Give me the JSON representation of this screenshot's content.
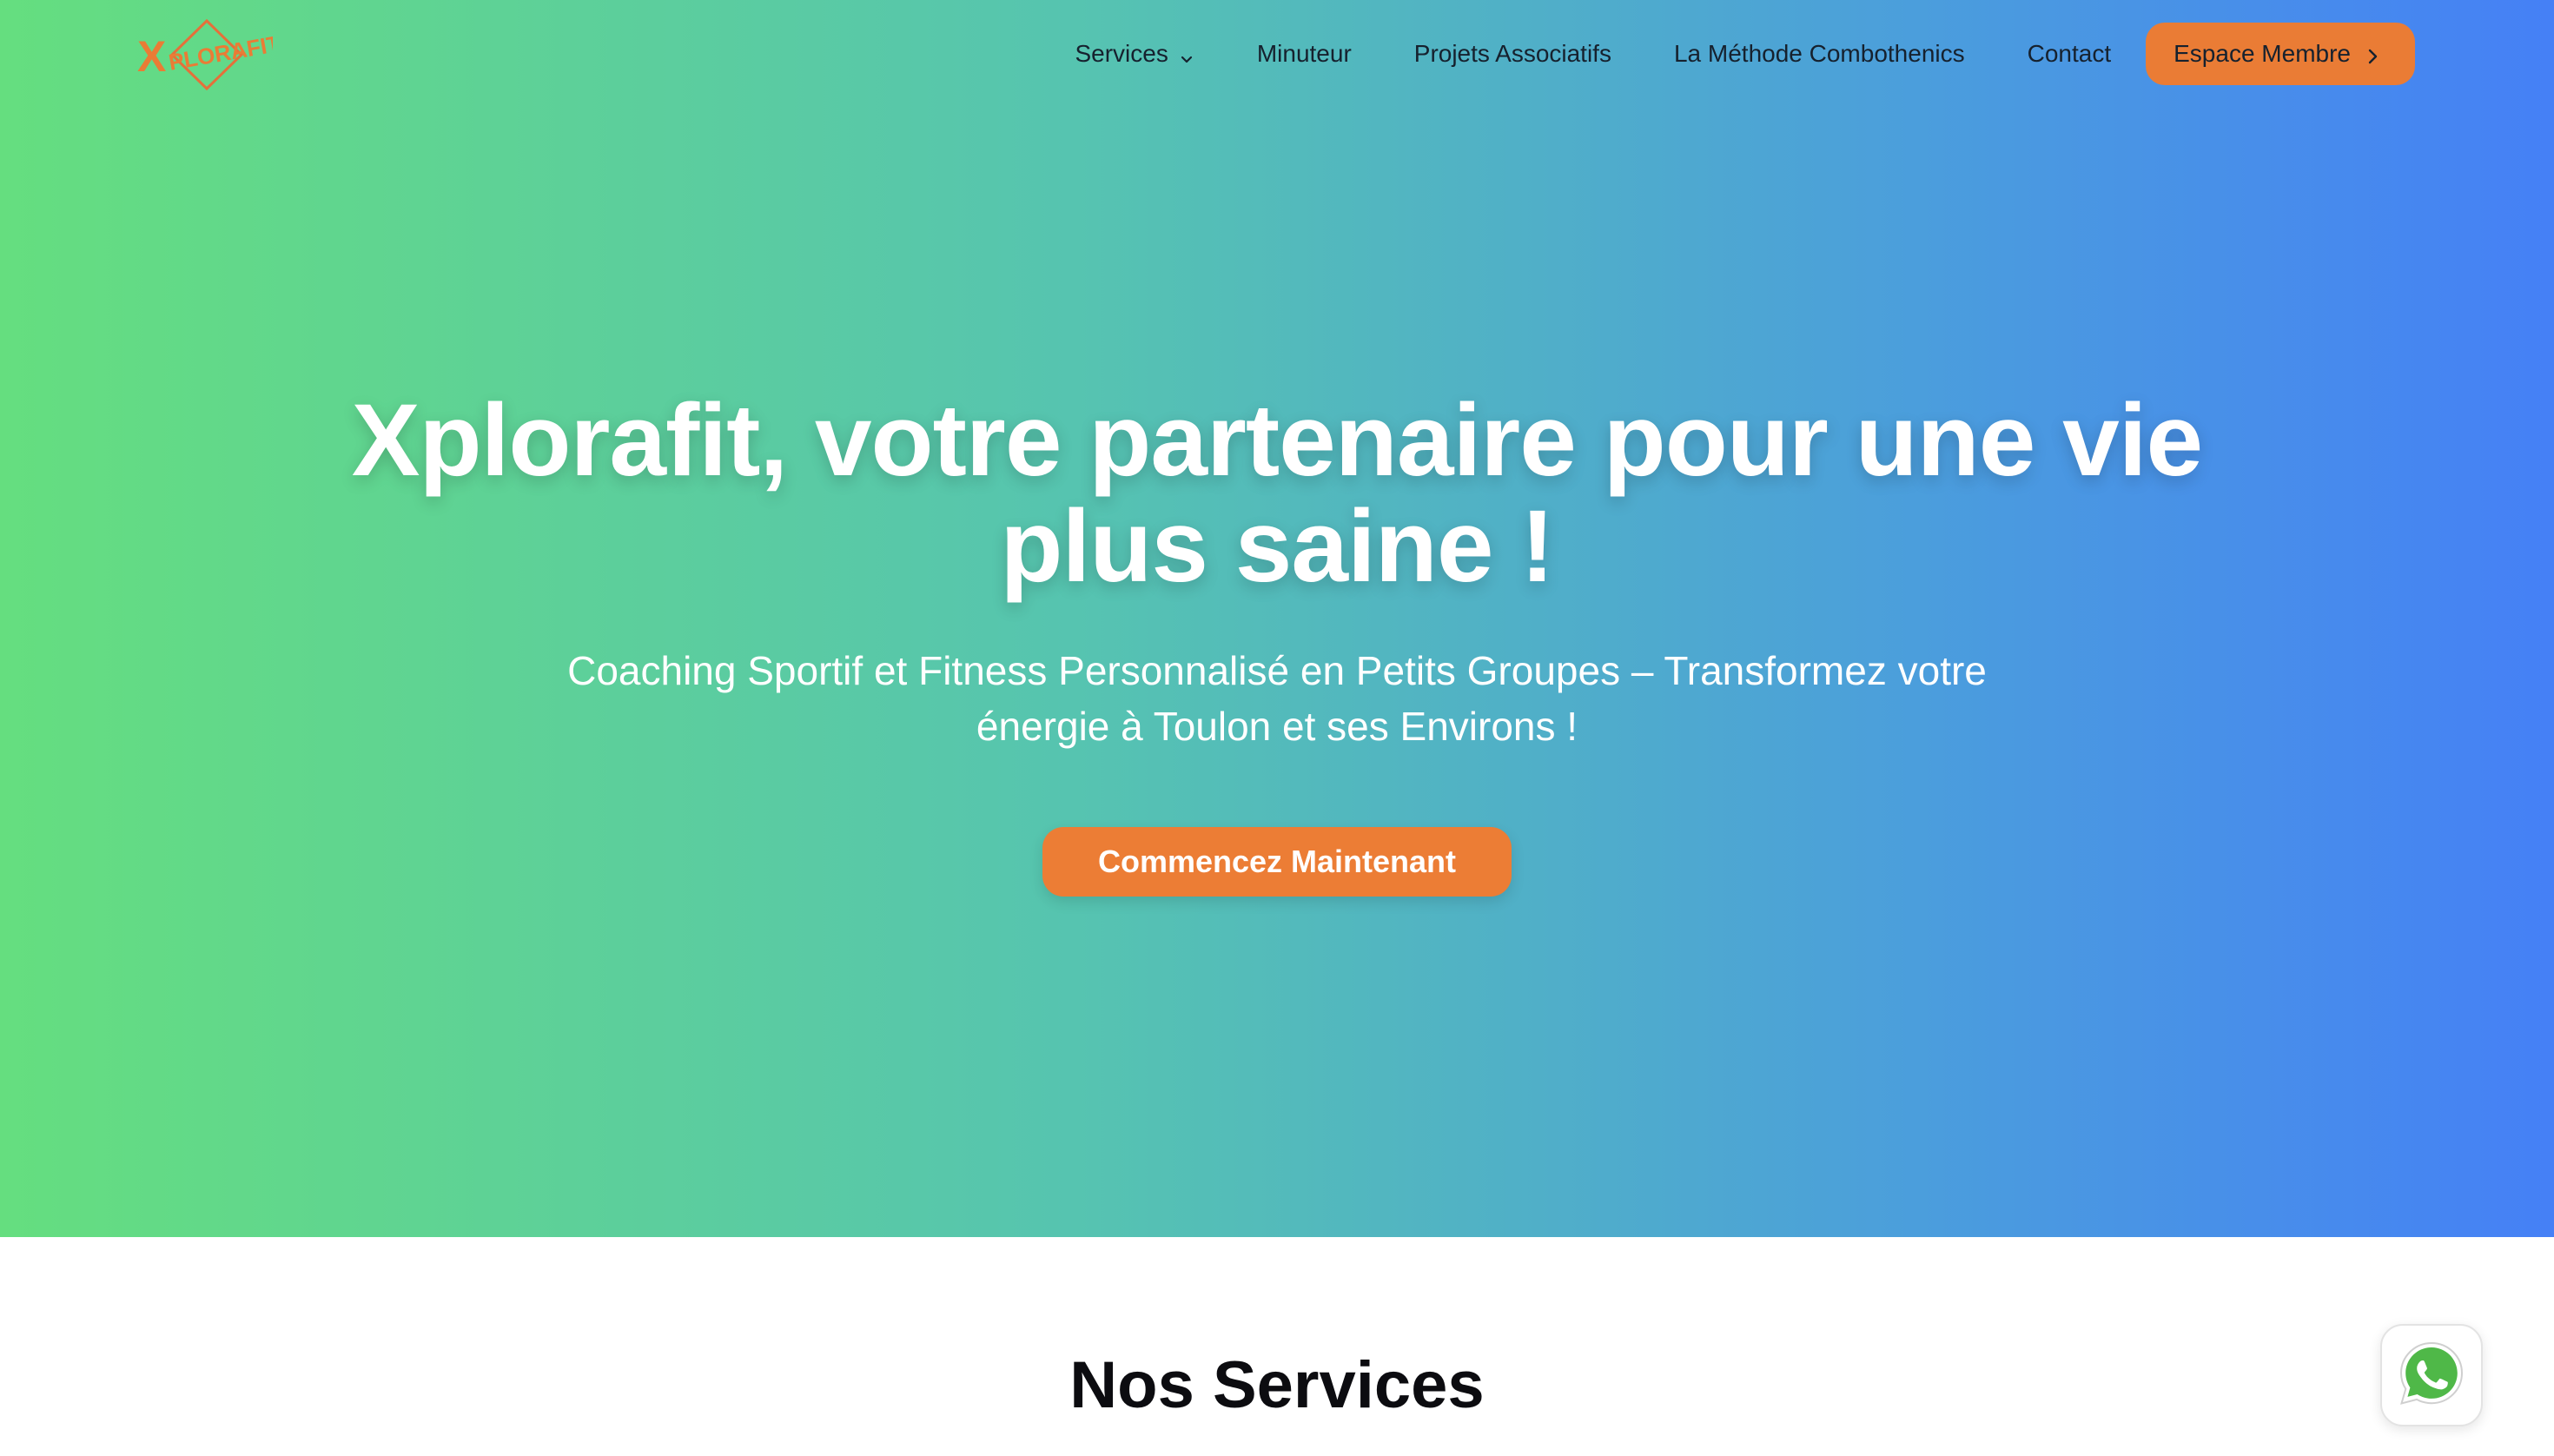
{
  "brand": {
    "logo_text": "XPLORAFIT",
    "accent_color": "#ea7c35"
  },
  "nav": {
    "items": [
      {
        "label": "Services",
        "icon": "chevron-down-icon"
      },
      {
        "label": "Minuteur"
      },
      {
        "label": "Projets Associatifs"
      },
      {
        "label": "La Méthode Combothenics"
      },
      {
        "label": "Contact"
      }
    ],
    "member_button": {
      "label": "Espace Membre",
      "icon": "chevron-right-icon"
    }
  },
  "hero": {
    "title": "Xplorafit, votre partenaire pour une vie plus saine !",
    "subtitle": "Coaching Sportif et Fitness Personnalisé en Petits Groupes – Transformez votre énergie à Toulon et ses Environs !",
    "cta_label": "Commencez Maintenant",
    "gradient": [
      "#65de7f",
      "#4580f6"
    ]
  },
  "services": {
    "title": "Nos Services"
  },
  "floating": {
    "whatsapp_icon": "whatsapp-icon",
    "whatsapp_color": "#4fb848"
  }
}
